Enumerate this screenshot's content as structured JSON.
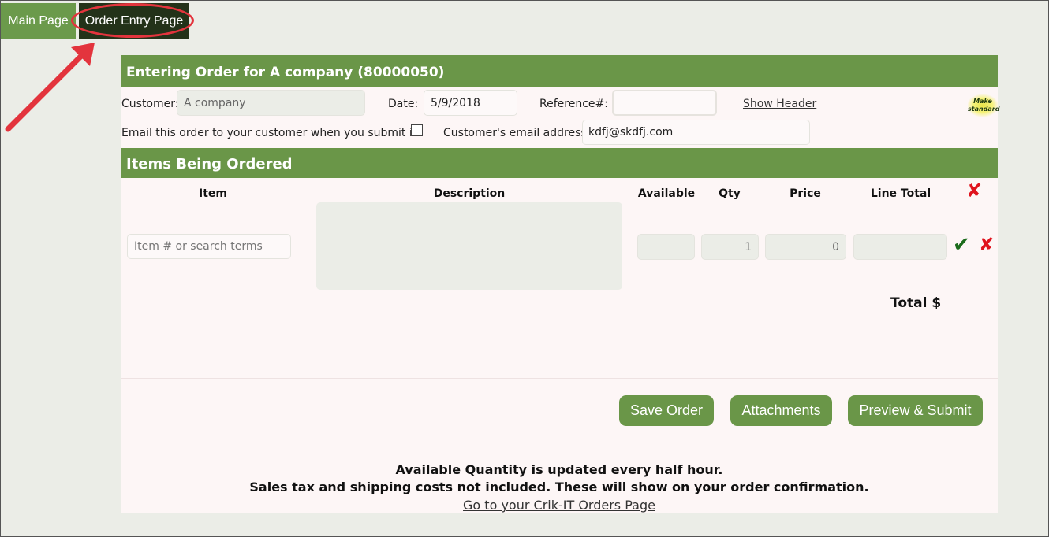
{
  "tabs": {
    "main": "Main Page",
    "order_entry": "Order Entry Page"
  },
  "header": {
    "title": "Entering Order for A company (80000050)"
  },
  "form": {
    "customer_label": "Customer:",
    "customer_value": "A company",
    "date_label": "Date:",
    "date_value": "5/9/2018",
    "reference_label": "Reference#:",
    "reference_value": "",
    "show_header_link": "Show Header",
    "make_standard_line1": "Make",
    "make_standard_line2": "standard",
    "email_question": "Email this order to your customer when you submit it?",
    "email_checked": false,
    "customer_email_label": "Customer's email address:",
    "customer_email_value": "kdfj@skdfj.com"
  },
  "items": {
    "section_title": "Items Being Ordered",
    "columns": [
      "Item",
      "Description",
      "Available",
      "Qty",
      "Price",
      "Line Total"
    ],
    "row": {
      "item_placeholder": "Item # or search terms",
      "description": "",
      "available": "",
      "qty": "1",
      "price": "0",
      "line_total": ""
    },
    "total_label": "Total $"
  },
  "icons": {
    "delete": "x-icon",
    "confirm": "checkmark-icon",
    "annotation_arrow": "red-arrow"
  },
  "buttons": {
    "save": "Save Order",
    "attachments": "Attachments",
    "preview_submit": "Preview & Submit"
  },
  "footer": {
    "line1": "Available Quantity is updated every half hour.",
    "line2": "Sales tax and shipping costs not included. These will show on your order confirmation.",
    "link": "Go to your Crik-IT Orders Page"
  },
  "colors": {
    "accent_green": "#6a9648",
    "active_tab": "#233219",
    "delete_red": "#e0141e",
    "confirm_green": "#1b6b1b",
    "annotation_red": "#e3343d"
  }
}
